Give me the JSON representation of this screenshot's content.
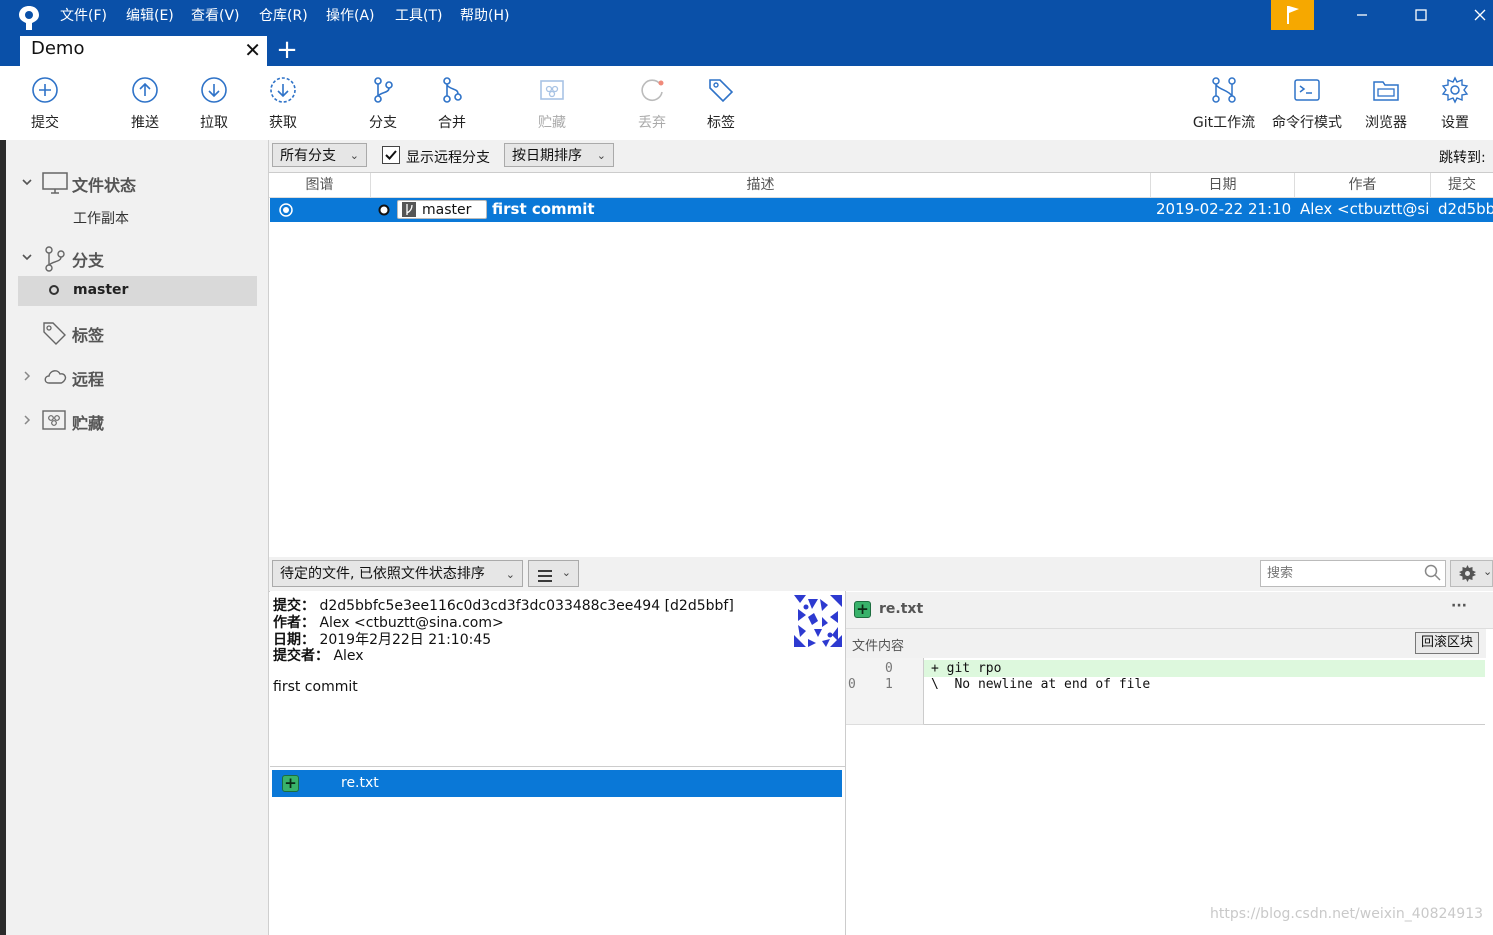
{
  "menu": {
    "items": [
      "文件(F)",
      "编辑(E)",
      "查看(V)",
      "仓库(R)",
      "操作(A)",
      "工具(T)",
      "帮助(H)"
    ]
  },
  "tabs": {
    "active": "Demo",
    "close": "✕",
    "new": "+"
  },
  "toolbar": {
    "commit": "提交",
    "push": "推送",
    "pull": "拉取",
    "fetch": "获取",
    "branch": "分支",
    "merge": "合并",
    "stash": "贮藏",
    "discard": "丢弃",
    "tag": "标签",
    "gitflow": "Git工作流",
    "terminal": "命令行模式",
    "explorer": "浏览器",
    "settings": "设置"
  },
  "sidebar": {
    "file_status": "文件状态",
    "working_copy": "工作副本",
    "branches": "分支",
    "branch_master": "master",
    "tags": "标签",
    "remotes": "远程",
    "stashes": "贮藏"
  },
  "filter": {
    "all_branches": "所有分支",
    "show_remote": "显示远程分支",
    "show_remote_checked": true,
    "sort": "按日期排序",
    "jump_to": "跳转到:"
  },
  "columns": {
    "graph": "图谱",
    "description": "描述",
    "date": "日期",
    "author": "作者",
    "commit": "提交"
  },
  "commits": [
    {
      "branch": "master",
      "message": "first commit",
      "date": "2019-02-22 21:10",
      "author": "Alex <ctbuztt@si",
      "hash": "d2d5bb"
    }
  ],
  "lower": {
    "pending_sort": "待定的文件, 已依照文件状态排序",
    "search_placeholder": "搜索"
  },
  "details": {
    "commit_label": "提交：",
    "commit_value": "d2d5bbfc5e3ee116c0d3cd3f3dc033488c3ee494 [d2d5bbf]",
    "author_label": "作者：",
    "author_value": "Alex <ctbuztt@sina.com>",
    "date_label": "日期：",
    "date_value": "2019年2月22日 21:10:45",
    "committer_label": "提交者：",
    "committer_value": "Alex",
    "message": "first commit"
  },
  "files": [
    {
      "name": "re.txt",
      "status": "added"
    }
  ],
  "diff": {
    "file": "re.txt",
    "more": "···",
    "hunk_title": "文件内容",
    "hunk_button": "回滚区块",
    "lines": [
      {
        "old": "",
        "new": "0",
        "text": "+ git rpo"
      },
      {
        "old": "0",
        "new": "1",
        "text": "\\  No newline at end of file"
      }
    ]
  },
  "watermark": "https://blog.csdn.net/weixin_40824913",
  "colors": {
    "titlebar": "#0a50a8",
    "selection": "#0a78d7",
    "flag": "#f6a800",
    "added": "#38b26a"
  }
}
